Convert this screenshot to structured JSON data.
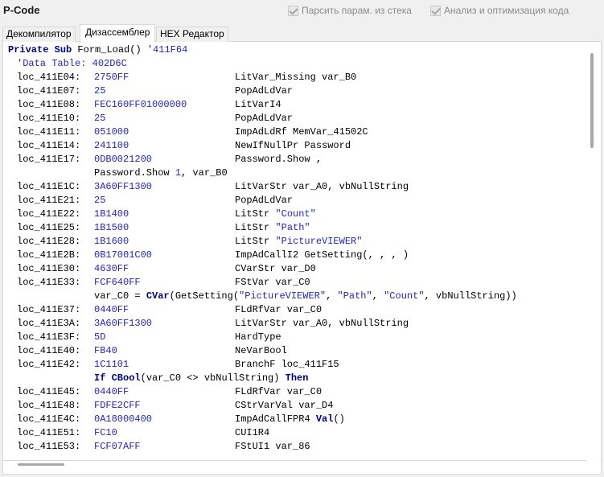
{
  "app": {
    "title": "P-Code"
  },
  "options": {
    "parse_params": "Парсить парам. из стека",
    "analyze_optimize": "Анализ и оптимизация кода"
  },
  "tabs": [
    "Декомпилятор",
    "Дизассемблер",
    "HEX Редактор"
  ],
  "code": {
    "header_kw1": "Private",
    "header_kw2": "Sub",
    "header_name": " Form_Load() ",
    "header_addr": "'411F64",
    "comment": "'Data Table: 402D6C",
    "lines": [
      {
        "addr": "loc_411E04:",
        "hex": "2750FF",
        "ins": "LitVar_Missing var_B0"
      },
      {
        "addr": "loc_411E07:",
        "hex": "25",
        "ins": "PopAdLdVar"
      },
      {
        "addr": "loc_411E08:",
        "hex": "FEC160FF01000000",
        "ins": "LitVarI4"
      },
      {
        "addr": "loc_411E10:",
        "hex": "25",
        "ins": "PopAdLdVar"
      },
      {
        "addr": "loc_411E11:",
        "hex": "051000",
        "ins": "ImpAdLdRf MemVar_41502C"
      },
      {
        "addr": "loc_411E14:",
        "hex": "241100",
        "ins": "NewIfNullPr Password"
      },
      {
        "addr": "loc_411E17:",
        "hex": "0DB0021200",
        "ins": "Password.Show ,"
      },
      {
        "addr": "loc_411E1C:",
        "hex": "3A60FF1300",
        "ins": "LitVarStr var_A0, vbNullString"
      },
      {
        "addr": "loc_411E21:",
        "hex": "25",
        "ins": "PopAdLdVar"
      },
      {
        "addr": "loc_411E22:",
        "hex": "1B1400",
        "ins": "LitStr ",
        "str": "\"Count\""
      },
      {
        "addr": "loc_411E25:",
        "hex": "1B1500",
        "ins": "LitStr ",
        "str": "\"Path\""
      },
      {
        "addr": "loc_411E28:",
        "hex": "1B1600",
        "ins": "LitStr ",
        "str": "\"PictureVIEWER\""
      },
      {
        "addr": "loc_411E2B:",
        "hex": "0B17001C00",
        "ins": "ImpAdCallI2 GetSetting(, , , )"
      },
      {
        "addr": "loc_411E30:",
        "hex": "4630FF",
        "ins": "CVarStr var_D0"
      },
      {
        "addr": "loc_411E33:",
        "hex": "FCF640FF",
        "ins": "FStVar var_C0"
      },
      {
        "addr": "loc_411E37:",
        "hex": "0440FF",
        "ins": "FLdRfVar var_C0"
      },
      {
        "addr": "loc_411E3A:",
        "hex": "3A60FF1300",
        "ins": "LitVarStr var_A0, vbNullString"
      },
      {
        "addr": "loc_411E3F:",
        "hex": "5D",
        "ins": "HardType"
      },
      {
        "addr": "loc_411E40:",
        "hex": "FB40",
        "ins": "NeVarBool"
      },
      {
        "addr": "loc_411E42:",
        "hex": "1C1101",
        "ins": "BranchF loc_411F15"
      },
      {
        "addr": "loc_411E45:",
        "hex": "0440FF",
        "ins": "FLdRfVar var_C0"
      },
      {
        "addr": "loc_411E48:",
        "hex": "FDFE2CFF",
        "ins": "CStrVarVal var_D4"
      },
      {
        "addr": "loc_411E4C:",
        "hex": "0A18000400",
        "ins": "ImpAdCallFPR4 ",
        "kw": "Val",
        "tail": "()"
      },
      {
        "addr": "loc_411E51:",
        "hex": "FC10",
        "ins": "CUI1R4"
      },
      {
        "addr": "loc_411E53:",
        "hex": "FCF07AFF",
        "ins": "FStUI1 var_86"
      }
    ],
    "src_show": "Password.Show 1, var_B0",
    "src_show_num": "1",
    "src_cvar": {
      "a": "var_C0 = ",
      "kw": "CVar",
      "b": "(GetSetting(",
      "s1": "\"PictureVIEWER\"",
      "c1": ", ",
      "s2": "\"Path\"",
      "c2": ", ",
      "s3": "\"Count\"",
      "c3": ", vbNullString))"
    },
    "src_if": {
      "kw_if": "If",
      "kw_cbool": "CBool",
      "mid": "(var_C0 <> vbNullString) ",
      "kw_then": "Then"
    }
  }
}
